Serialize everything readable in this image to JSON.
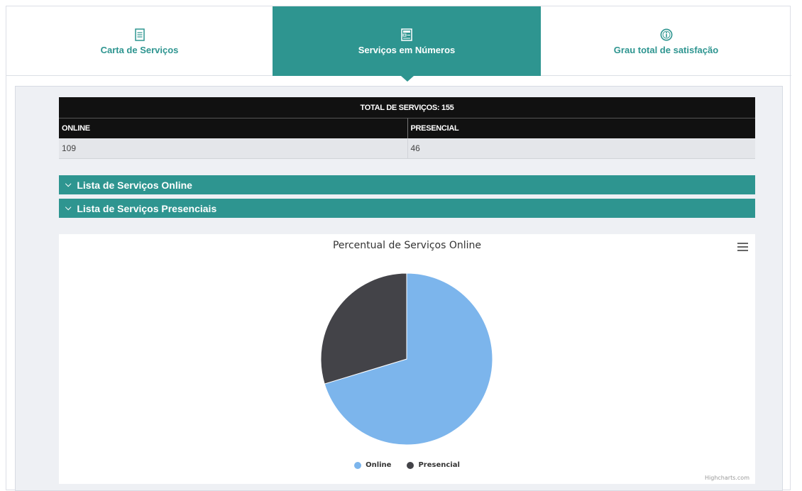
{
  "tabs": [
    {
      "label": "Carta de Serviços",
      "icon": "document-icon",
      "active": false
    },
    {
      "label": "Serviços em Números",
      "icon": "stats-document-icon",
      "active": true
    },
    {
      "label": "Grau total de satisfação",
      "icon": "info-circle-icon",
      "active": false
    }
  ],
  "table": {
    "header": "TOTAL DE SERVIÇOS: 155",
    "columns": [
      "ONLINE",
      "PRESENCIAL"
    ],
    "values": [
      "109",
      "46"
    ]
  },
  "accordions": [
    {
      "label": "Lista de Serviços Online"
    },
    {
      "label": "Lista de Serviços Presenciais"
    }
  ],
  "colors": {
    "accent": "#2e9590",
    "online": "#7cb5ec",
    "presencial": "#434348"
  },
  "chart_data": {
    "type": "pie",
    "title": "Percentual de Serviços Online",
    "slices": [
      {
        "name": "Online",
        "value": 109,
        "color": "#7cb5ec"
      },
      {
        "name": "Presencial",
        "value": 46,
        "color": "#434348"
      }
    ],
    "legend": "bottom",
    "credits": "Highcharts.com"
  }
}
